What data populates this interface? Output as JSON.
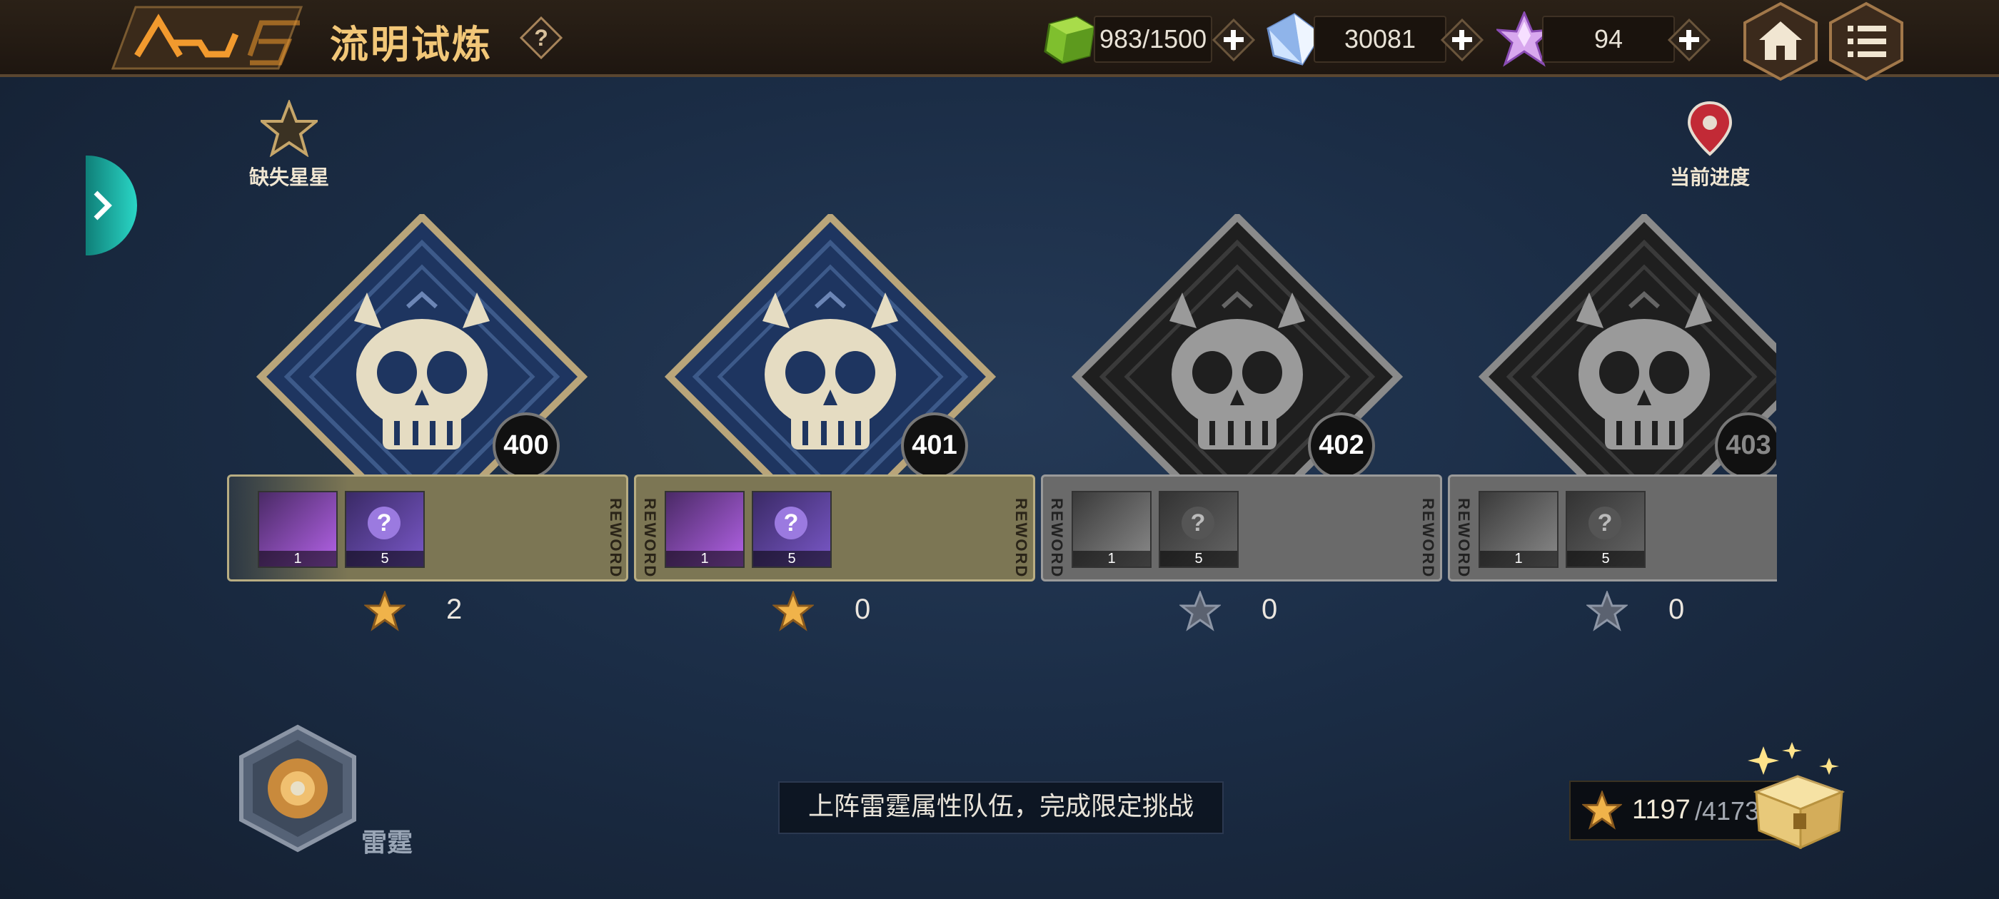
{
  "header": {
    "title": "流明试炼",
    "help_icon": "question-icon",
    "resources": [
      {
        "name": "stamina",
        "icon": "green-cube-icon",
        "value": "983/1500"
      },
      {
        "name": "crystal",
        "icon": "blue-crystal-icon",
        "value": "30081"
      },
      {
        "name": "gem",
        "icon": "purple-crystal-icon",
        "value": "94"
      }
    ],
    "home_icon": "home-icon",
    "menu_icon": "menu-list-icon"
  },
  "markers": {
    "missing_stars": "缺失星星",
    "current_progress": "当前进度"
  },
  "stages": [
    {
      "number": "400",
      "state": "unlocked",
      "stars": "2",
      "reward_label": "REWORD",
      "rewards": [
        {
          "icon": "ticket-card-icon",
          "count": "1"
        },
        {
          "icon": "mystery-card-icon",
          "count": "5"
        }
      ]
    },
    {
      "number": "401",
      "state": "unlocked",
      "stars": "0",
      "reward_label": "REWORD",
      "rewards": [
        {
          "icon": "ticket-card-icon",
          "count": "1"
        },
        {
          "icon": "mystery-card-icon",
          "count": "5"
        }
      ]
    },
    {
      "number": "402",
      "state": "locked",
      "stars": "0",
      "reward_label": "REWORD",
      "rewards": [
        {
          "icon": "ticket-card-icon",
          "count": "1"
        },
        {
          "icon": "mystery-card-icon",
          "count": "5"
        }
      ]
    },
    {
      "number": "403",
      "state": "locked",
      "stars": "0",
      "reward_label": "REWORD",
      "rewards": [
        {
          "icon": "ticket-card-icon",
          "count": "1"
        },
        {
          "icon": "mystery-card-icon",
          "count": "5"
        }
      ]
    }
  ],
  "element": {
    "label": "雷霆",
    "icon": "thunder-flower-emblem-icon"
  },
  "tip": "上阵雷霆属性队伍，完成限定挑战",
  "star_total": {
    "current": "1197",
    "max": "/4173",
    "icon": "gold-star-icon"
  },
  "chest_icon": "treasure-chest-icon",
  "colors": {
    "gold": "#f2c778",
    "unlocked_panel": "#2a4a7a",
    "locked_panel": "#262626",
    "teal": "#2ad6c6"
  }
}
